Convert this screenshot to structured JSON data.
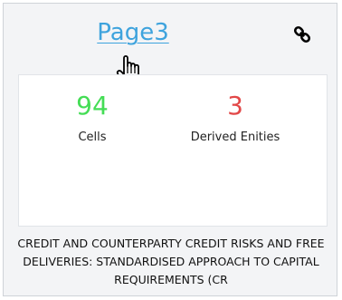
{
  "card": {
    "title": "Page3",
    "link_icon": "link-icon",
    "cursor_icon": "hand-pointer-icon",
    "stats": {
      "cells": {
        "value": "94",
        "label": "Cells",
        "color": "#44dd55"
      },
      "derived": {
        "value": "3",
        "label": "Derived Enities",
        "color": "#e24848"
      }
    },
    "description": "CREDIT AND COUNTERPARTY CREDIT RISKS AND FREE DELIVERIES: STANDARDISED APPROACH TO CAPITAL REQUIREMENTS (CR"
  },
  "colors": {
    "title": "#3ea3dd",
    "card_background": "#f3f4f6",
    "panel_background": "#ffffff"
  }
}
